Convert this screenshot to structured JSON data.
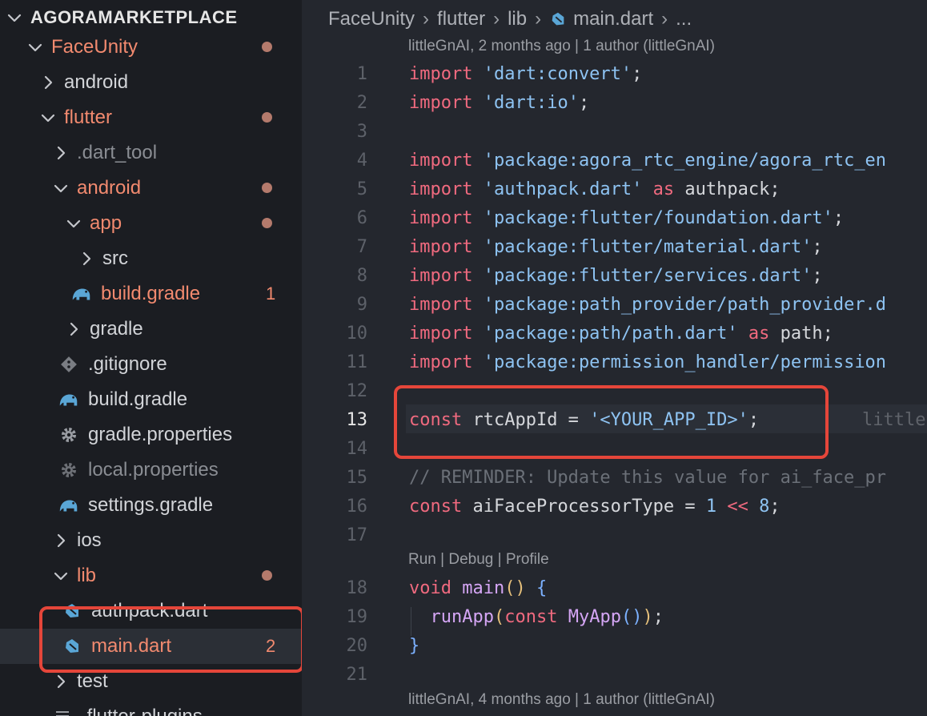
{
  "explorer": {
    "header": "AGORAMARKETPLACE",
    "items": [
      {
        "label": "FaceUnity",
        "state": "mod",
        "dot": true
      },
      {
        "label": "android",
        "state": "normal"
      },
      {
        "label": "flutter",
        "state": "mod",
        "dot": true
      },
      {
        "label": ".dart_tool",
        "state": "dim"
      },
      {
        "label": "android",
        "state": "mod",
        "dot": true
      },
      {
        "label": "app",
        "state": "mod",
        "dot": true
      },
      {
        "label": "src",
        "state": "normal"
      },
      {
        "label": "build.gradle",
        "state": "mod",
        "badge": "1",
        "icon": "gradle-elephant-icon"
      },
      {
        "label": "gradle",
        "state": "normal"
      },
      {
        "label": ".gitignore",
        "state": "normal",
        "icon": "git-icon"
      },
      {
        "label": "build.gradle",
        "state": "normal",
        "icon": "gradle-elephant-icon"
      },
      {
        "label": "gradle.properties",
        "state": "normal",
        "icon": "gear-icon"
      },
      {
        "label": "local.properties",
        "state": "dim",
        "icon": "gear-icon"
      },
      {
        "label": "settings.gradle",
        "state": "normal",
        "icon": "gradle-elephant-icon"
      },
      {
        "label": "ios",
        "state": "normal"
      },
      {
        "label": "lib",
        "state": "mod",
        "dot": true
      },
      {
        "label": "authpack.dart",
        "state": "normal",
        "icon": "dart-icon"
      },
      {
        "label": "main.dart",
        "state": "mod",
        "badge": "2",
        "icon": "dart-icon",
        "selected": true
      },
      {
        "label": "test",
        "state": "normal"
      },
      {
        "label": ".flutter-plugins",
        "state": "normal"
      }
    ]
  },
  "breadcrumb": {
    "parts": [
      "FaceUnity",
      "flutter",
      "lib",
      "main.dart",
      "..."
    ]
  },
  "editor": {
    "codelens_top": "littleGnAI, 2 months ago | 1 author (littleGnAI)",
    "codelens_run": "Run | Debug | Profile",
    "codelens_bottom": "littleGnAI, 4 months ago | 1 author (littleGnAI)",
    "line_numbers": [
      "1",
      "2",
      "3",
      "4",
      "5",
      "6",
      "7",
      "8",
      "9",
      "10",
      "11",
      "12",
      "13",
      "14",
      "15",
      "16",
      "17",
      "18",
      "19",
      "20",
      "21"
    ],
    "active_line": "13",
    "lines": {
      "l1_str": "'dart:convert'",
      "l2_str": "'dart:io'",
      "l4_str": "'package:agora_rtc_engine/agora_rtc_en",
      "l5_str": "'authpack.dart'",
      "l5_alias": " authpack;",
      "l6_str": "'package:flutter/foundation.dart'",
      "l7_str": "'package:flutter/material.dart'",
      "l8_str": "'package:flutter/services.dart'",
      "l9_str": "'package:path_provider/path_provider.d",
      "l10_str": "'package:path/path.dart'",
      "l10_alias": " path;",
      "l11_str": "'package:permission_handler/permission",
      "l13_name": " rtcAppId = ",
      "l13_str": "'<YOUR_APP_ID>'",
      "l13_blame": "little",
      "l15_comment": "// REMINDER: Update this value for ai_face_pr",
      "l16_name": " aiFaceProcessorType = ",
      "l16_num1": "1",
      "l16_op": " << ",
      "l16_num2": "8",
      "l18_kw": "void",
      "l18_fn": "main",
      "l19_fn": "runApp",
      "l19_cls": "MyApp"
    },
    "keywords": {
      "import": "import",
      "const": "const",
      "as": "as"
    }
  },
  "colors": {
    "modified": "#f28a6f",
    "annotation_red": "#e5463a",
    "keyword": "#f06a7f",
    "string": "#8ec3f2"
  }
}
